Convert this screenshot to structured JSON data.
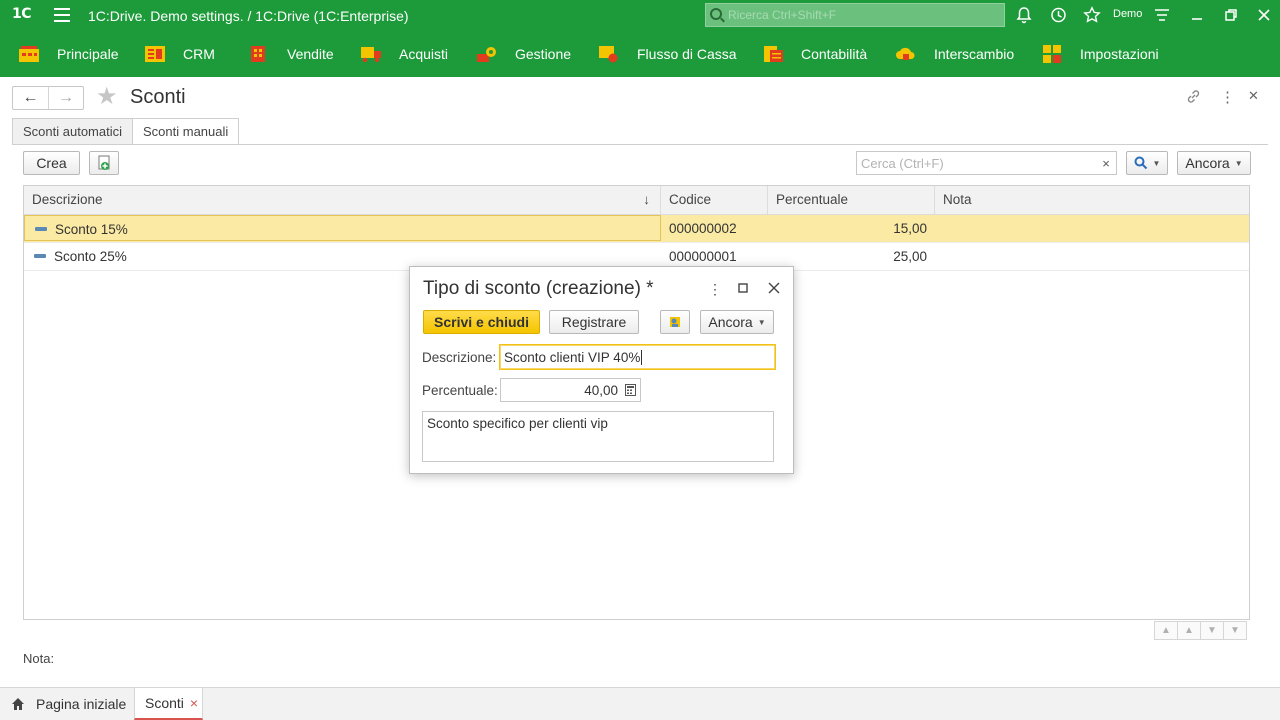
{
  "titlebar": {
    "logo": "1C",
    "title": "1C:Drive. Demo settings. / 1C:Drive  (1C:Enterprise)",
    "search_placeholder": "Ricerca Ctrl+Shift+F",
    "user": "Demo"
  },
  "sections": [
    {
      "label": "Principale",
      "icon": "home-section-icon"
    },
    {
      "label": "CRM",
      "icon": "crm-icon"
    },
    {
      "label": "Vendite",
      "icon": "sales-icon"
    },
    {
      "label": "Acquisti",
      "icon": "purchases-truck-icon"
    },
    {
      "label": "Gestione",
      "icon": "gear-icon"
    },
    {
      "label": "Flusso di Cassa",
      "icon": "cash-flow-icon"
    },
    {
      "label": "Contabilità",
      "icon": "accounting-icon"
    },
    {
      "label": "Interscambio",
      "icon": "cloud-exchange-icon"
    },
    {
      "label": "Impostazioni",
      "icon": "settings-grid-icon"
    }
  ],
  "form": {
    "title": "Sconti",
    "tabs": [
      {
        "label": "Sconti automatici",
        "active": false
      },
      {
        "label": "Sconti manuali",
        "active": true
      }
    ],
    "toolbar": {
      "create_label": "Crea",
      "search_placeholder": "Cerca (Ctrl+F)",
      "clear_label": "×",
      "more_label": "Ancora"
    },
    "table": {
      "columns": [
        "Descrizione",
        "Codice",
        "Percentuale",
        "Nota"
      ],
      "sort_indicator": "↓",
      "rows": [
        {
          "descrizione": "Sconto 15%",
          "codice": "000000002",
          "percentuale": "15,00",
          "nota": "",
          "selected": true
        },
        {
          "descrizione": "Sconto 25%",
          "codice": "000000001",
          "percentuale": "25,00",
          "nota": "",
          "selected": false
        }
      ]
    },
    "nota_label": "Nota:"
  },
  "dialog": {
    "title": "Tipo di sconto (creazione) *",
    "write_close_label": "Scrivi e chiudi",
    "register_label": "Registrare",
    "more_label": "Ancora",
    "descrizione_label": "Descrizione:",
    "descrizione_value": "Sconto clienti VIP 40%",
    "percentuale_label": "Percentuale:",
    "percentuale_value": "40,00",
    "note_value": "Sconto specifico per clienti vip"
  },
  "bottom_tabs": [
    {
      "label": "Pagina iniziale",
      "active": false
    },
    {
      "label": "Sconti",
      "active": true,
      "close": "×"
    }
  ],
  "colors": {
    "brand_green": "#1d9b3a",
    "selection_yellow": "#fbeaa4",
    "primary_button": "#f5c400"
  }
}
